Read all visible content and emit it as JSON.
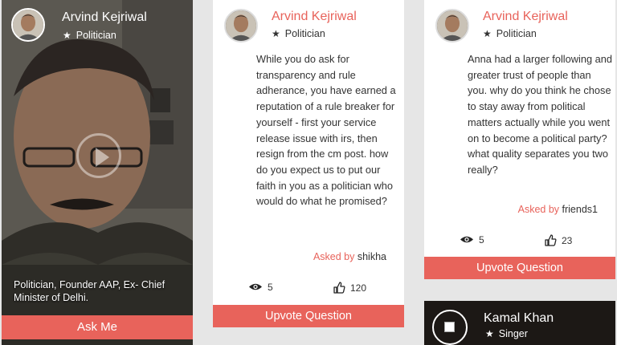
{
  "video_card": {
    "name": "Arvind Kejriwal",
    "role": "Politician",
    "caption": "Politician, Founder AAP, Ex- Chief Minister of Delhi.",
    "ask_button": "Ask Me"
  },
  "questions": [
    {
      "name": "Arvind Kejriwal",
      "role": "Politician",
      "text": "While you do ask for transparency and rule adherance, you have earned a reputation of a rule breaker for yourself - first your service release issue with irs, then resign from the cm post. how do you expect us to put our faith in you as a politician who would do what he promised?",
      "asked_by_label": "Asked by",
      "asked_by_user": "shikha",
      "views": "5",
      "votes": "120",
      "upvote_label": "Upvote Question"
    },
    {
      "name": "Arvind Kejriwal",
      "role": "Politician",
      "text": "Anna had a larger following and greater trust of people than you. why do you think he chose to stay away from political matters actually while you went on to become a political party? what quality separates you two really?",
      "asked_by_label": "Asked by",
      "asked_by_user": "friends1",
      "views": "5",
      "votes": "23",
      "upvote_label": "Upvote Question"
    }
  ],
  "kamal_card": {
    "name": "Kamal Khan",
    "role": "Singer"
  },
  "icons": {
    "role": "star-icon",
    "views": "eye-icon",
    "votes": "thumbs-up-icon",
    "play": "play-icon"
  },
  "colors": {
    "accent": "#e8635b",
    "background": "#e6e6e6"
  }
}
